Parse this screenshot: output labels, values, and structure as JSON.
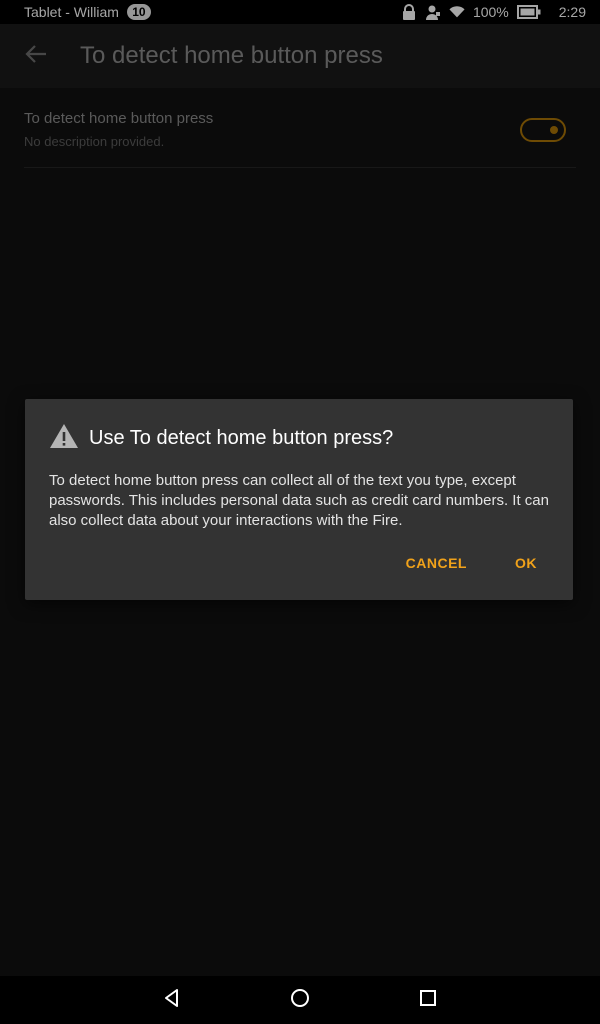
{
  "status_bar": {
    "title": "Tablet - William",
    "badge": "10",
    "battery": "100%",
    "time": "2:29",
    "icons": [
      "lock-icon",
      "user-icon",
      "wifi-icon",
      "battery-icon"
    ]
  },
  "action_bar": {
    "title": "To detect home button press",
    "back_icon": "arrow-back-icon"
  },
  "setting": {
    "title": "To detect home button press",
    "description": "No description provided.",
    "toggle_state": "off"
  },
  "dialog": {
    "icon": "warning-icon",
    "title": "Use To detect home button press?",
    "message": "To detect home button press can collect all of the text you type, except passwords. This includes personal data such as credit card numbers. It can also collect data about your interactions with the Fire.",
    "cancel_label": "CANCEL",
    "ok_label": "OK"
  },
  "nav_bar": {
    "icons": [
      "back-triangle-icon",
      "home-circle-icon",
      "recents-square-icon"
    ]
  },
  "colors": {
    "accent": "#f1a21a",
    "toggle": "#a97407",
    "background": "#111111",
    "dialog": "#333333"
  }
}
